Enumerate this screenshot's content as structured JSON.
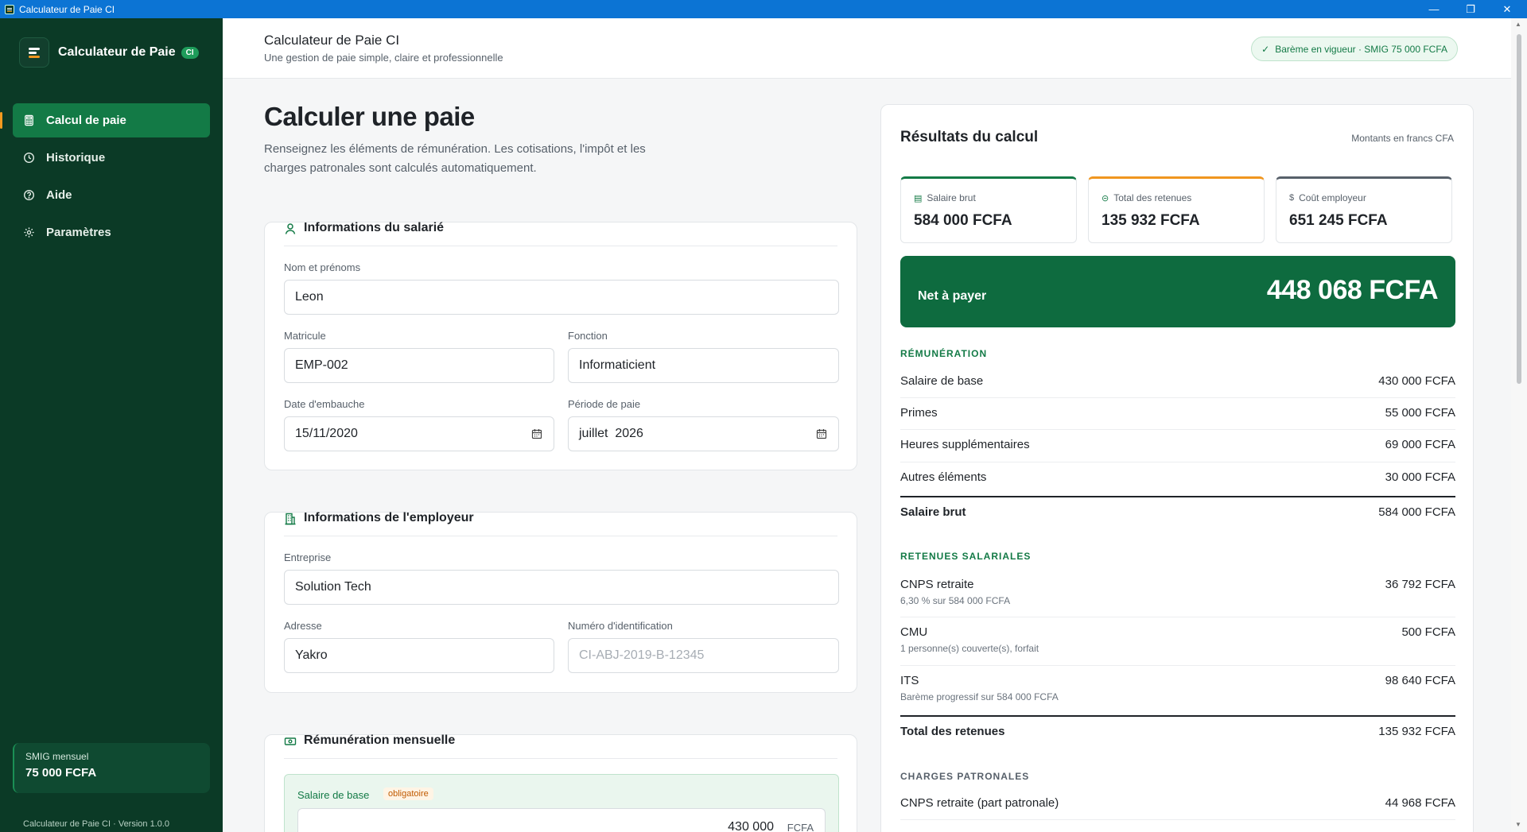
{
  "window": {
    "title": "Calculateur de Paie CI"
  },
  "sidebar": {
    "brand_name": "Calculateur de Paie",
    "brand_badge": "CI",
    "items": [
      {
        "label": "Calcul de paie",
        "icon": "calculator-icon",
        "active": true
      },
      {
        "label": "Historique",
        "icon": "clock-icon",
        "active": false
      },
      {
        "label": "Aide",
        "icon": "help-icon",
        "active": false
      },
      {
        "label": "Paramètres",
        "icon": "gear-icon",
        "active": false
      }
    ],
    "smig_label": "SMIG mensuel",
    "smig_value": "75 000 FCFA",
    "version": "Calculateur de Paie CI · Version 1.0.0"
  },
  "header": {
    "title": "Calculateur de Paie CI",
    "subtitle": "Une gestion de paie simple, claire et professionnelle",
    "badge": "Barème en vigueur · SMIG 75 000 FCFA"
  },
  "main": {
    "title": "Calculer une paie",
    "description": "Renseignez les éléments de rémunération. Les cotisations, l'impôt et les charges patronales sont calculés automatiquement.",
    "employee": {
      "title": "Informations du salarié",
      "name_label": "Nom et prénoms",
      "name_value": "Leon",
      "matricule_label": "Matricule",
      "matricule_value": "EMP-002",
      "fonction_label": "Fonction",
      "fonction_value": "Informaticient",
      "hire_label": "Date d'embauche",
      "hire_value": "15/11/2020",
      "period_label": "Période de paie",
      "period_value": "juillet  2026"
    },
    "employer": {
      "title": "Informations de l'employeur",
      "company_label": "Entreprise",
      "company_value": "Solution Tech",
      "address_label": "Adresse",
      "address_value": "Yakro",
      "id_label": "Numéro d'identification",
      "id_placeholder": "CI-ABJ-2019-B-12345"
    },
    "remuneration": {
      "title": "Rémunération mensuelle",
      "base_label": "Salaire de base",
      "required": "obligatoire",
      "base_value": "430 000",
      "unit": "FCFA"
    }
  },
  "results": {
    "title": "Résultats du calcul",
    "note": "Montants en francs CFA",
    "stats": [
      {
        "label": "Salaire brut",
        "value": "584 000 FCFA",
        "icon": "chart-icon",
        "color": "#137a46"
      },
      {
        "label": "Total des retenues",
        "value": "135 932 FCFA",
        "icon": "minus-circle-icon",
        "color": "#f0961f"
      },
      {
        "label": "Coût employeur",
        "value": "651 245 FCFA",
        "icon": "dollar-icon",
        "color": "#57606a"
      }
    ],
    "net_label": "Net à payer",
    "net_value": "448 068 FCFA",
    "remuneration": {
      "heading": "RÉMUNÉRATION",
      "rows": [
        {
          "label": "Salaire de base",
          "value": "430 000 FCFA"
        },
        {
          "label": "Primes",
          "value": "55 000 FCFA"
        },
        {
          "label": "Heures supplémentaires",
          "value": "69 000 FCFA"
        },
        {
          "label": "Autres éléments",
          "value": "30 000 FCFA"
        }
      ],
      "total_label": "Salaire brut",
      "total_value": "584 000 FCFA"
    },
    "retenues": {
      "heading": "RETENUES SALARIALES",
      "rows": [
        {
          "label": "CNPS retraite",
          "sub": "6,30 % sur 584 000 FCFA",
          "value": "36 792 FCFA"
        },
        {
          "label": "CMU",
          "sub": "1 personne(s) couverte(s), forfait",
          "value": "500 FCFA"
        },
        {
          "label": "ITS",
          "sub": "Barème progressif sur 584 000 FCFA",
          "value": "98 640 FCFA"
        }
      ],
      "total_label": "Total des retenues",
      "total_value": "135 932 FCFA"
    },
    "patronales": {
      "heading": "CHARGES PATRONALES",
      "rows": [
        {
          "label": "CNPS retraite (part patronale)",
          "value": "44 968 FCFA"
        }
      ]
    }
  }
}
